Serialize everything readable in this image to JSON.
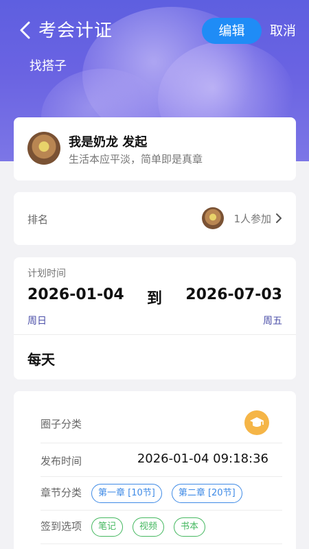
{
  "header": {
    "title": "考会计证",
    "subtitle": "找搭子",
    "edit_label": "编辑",
    "cancel_label": "取消"
  },
  "owner": {
    "name": "我是奶龙 发起",
    "bio": "生活本应平淡，简单即是真章"
  },
  "rank": {
    "label": "排名",
    "participants": "1人参加"
  },
  "plan": {
    "label": "计划时间",
    "start_date": "2026-01-04",
    "separator": "到",
    "end_date": "2026-07-03",
    "start_weekday": "周日",
    "end_weekday": "周五",
    "frequency": "每天"
  },
  "details": {
    "category_label": "圈子分类",
    "category_icon": "graduation-cap-icon",
    "publish_label": "发布时间",
    "publish_time": "2026-01-04 09:18:36",
    "chapter_label": "章节分类",
    "chapters": [
      "第一章 [10节]",
      "第二章 [20节]"
    ],
    "checkin_label": "签到选项",
    "checkin_options": [
      "笔记",
      "视频",
      "书本"
    ]
  },
  "colors": {
    "header_gradient_top": "#5e5fe0",
    "edit_button": "#1f8cf6",
    "weekday_text": "#4b4fa8",
    "chapter_chip": "#3e8ae6",
    "checkin_chip": "#45b860",
    "category_icon_bg": "#f5b547"
  }
}
